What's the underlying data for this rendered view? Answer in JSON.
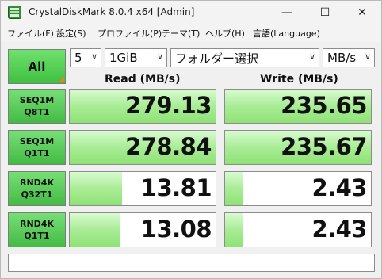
{
  "window": {
    "title": "CrystalDiskMark 8.0.4 x64 [Admin]",
    "controls": {
      "minimize": "—",
      "maximize": "☐",
      "close": "✕"
    }
  },
  "menu": [
    "ファイル(F)",
    "設定(S)",
    "プロファイル(P)",
    "テーマ(T)",
    "ヘルプ(H)",
    "言語(Language)"
  ],
  "controls": {
    "all_label": "All",
    "count": "5",
    "size": "1GiB",
    "drive": "フォルダー選択",
    "unit": "MB/s",
    "chevron": "∨"
  },
  "headers": {
    "read": "Read (MB/s)",
    "write": "Write (MB/s)"
  },
  "rows": [
    {
      "line1": "SEQ1M",
      "line2": "Q8T1",
      "read": "279.13",
      "write": "235.65",
      "read_fill": 1.0,
      "write_fill": 1.0
    },
    {
      "line1": "SEQ1M",
      "line2": "Q1T1",
      "read": "278.84",
      "write": "235.67",
      "read_fill": 1.0,
      "write_fill": 1.0
    },
    {
      "line1": "RND4K",
      "line2": "Q32T1",
      "read": "13.81",
      "write": "2.43",
      "read_fill": 0.36,
      "write_fill": 0.12
    },
    {
      "line1": "RND4K",
      "line2": "Q1T1",
      "read": "13.08",
      "write": "2.43",
      "read_fill": 0.35,
      "write_fill": 0.12
    }
  ],
  "colors": {
    "accent_green": "#4cc24c",
    "bar_green": "#a9ec95",
    "corner_orange": "#ff7a1a"
  },
  "comment": ""
}
